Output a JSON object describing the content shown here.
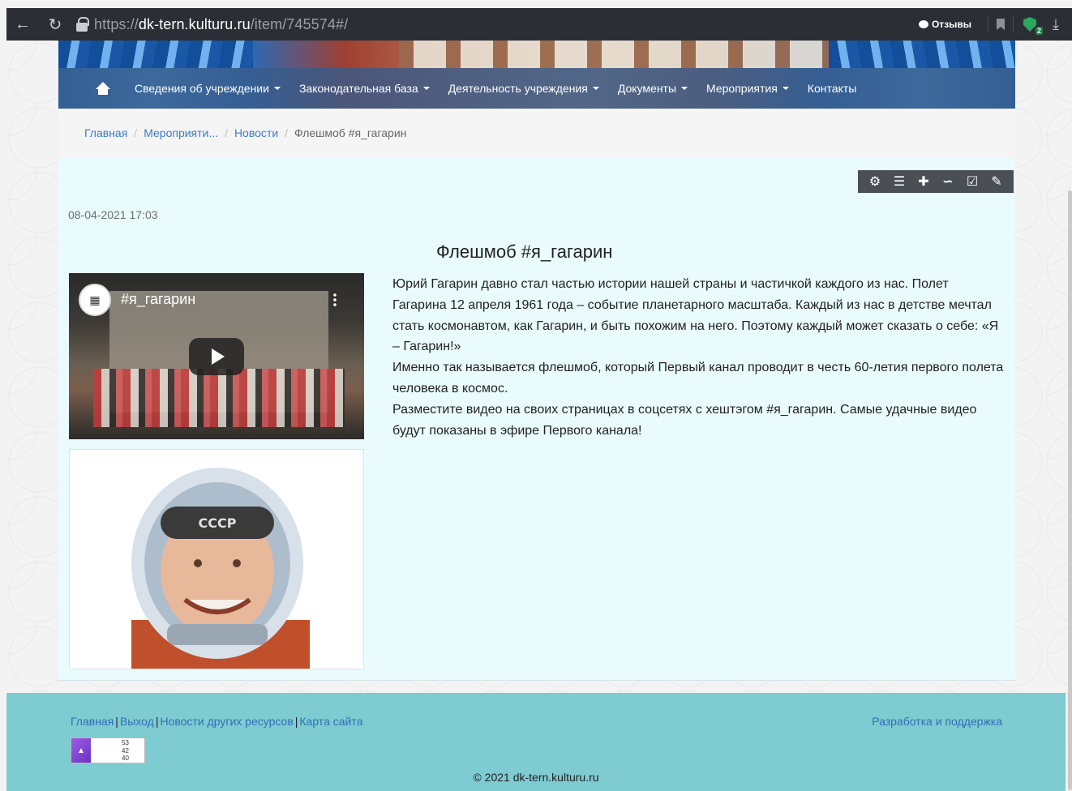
{
  "browser": {
    "url_proto": "https://",
    "url_host": "dk-tern.kulturu.ru",
    "url_path": "/item/745574#/",
    "reviews_label": "Отзывы",
    "shield_badge": "2"
  },
  "nav": {
    "items": [
      {
        "label": "Сведения об учреждении",
        "dropdown": true
      },
      {
        "label": "Законодательная база",
        "dropdown": true
      },
      {
        "label": "Деятельность учреждения",
        "dropdown": true
      },
      {
        "label": "Документы",
        "dropdown": true
      },
      {
        "label": "Мероприятия",
        "dropdown": true
      },
      {
        "label": "Контакты",
        "dropdown": false
      }
    ]
  },
  "breadcrumb": {
    "home": "Главная",
    "events": "Мероприяти...",
    "news": "Новости",
    "current": "Флешмоб #я_гагарин"
  },
  "toolbar": {
    "icons": [
      "gear-icon",
      "list-icon",
      "plus-icon",
      "paperclip-icon",
      "check-icon",
      "pencil-icon"
    ]
  },
  "article": {
    "date": "08-04-2021 17:03",
    "title": "Флешмоб #я_гагарин",
    "video_title": "#я_гагарин",
    "paragraphs": [
      "Юрий Гагарин давно стал частью истории нашей страны и частичкой каждого из нас. Полет Гагарина 12 апреля 1961 года – событие планетарного масштаба. Каждый из нас в детстве мечтал стать космонавтом, как Гагарин, и быть похожим на него. Поэтому каждый может сказать о себе: «Я – Гагарин!»",
      "Именно так называется флешмоб, который Первый канал проводит в честь 60-летия первого полета человека в космос.",
      "Разместите видео на своих страницах в соцсетях с хештэгом #я_гагарин. Самые удачные видео будут показаны в эфире Первого канала!"
    ]
  },
  "footer": {
    "links": [
      "Главная",
      "Выход",
      "Новости других ресурсов",
      "Карта сайта"
    ],
    "dev_link": "Разработка и поддержка",
    "counter": [
      "53",
      "42",
      "40"
    ],
    "copyright": "© 2021 dk-tern.kulturu.ru"
  },
  "colors": {
    "content_bg": "#e9fbfc",
    "footer_bg": "#7ecbd1",
    "link": "#3b7cc6"
  }
}
